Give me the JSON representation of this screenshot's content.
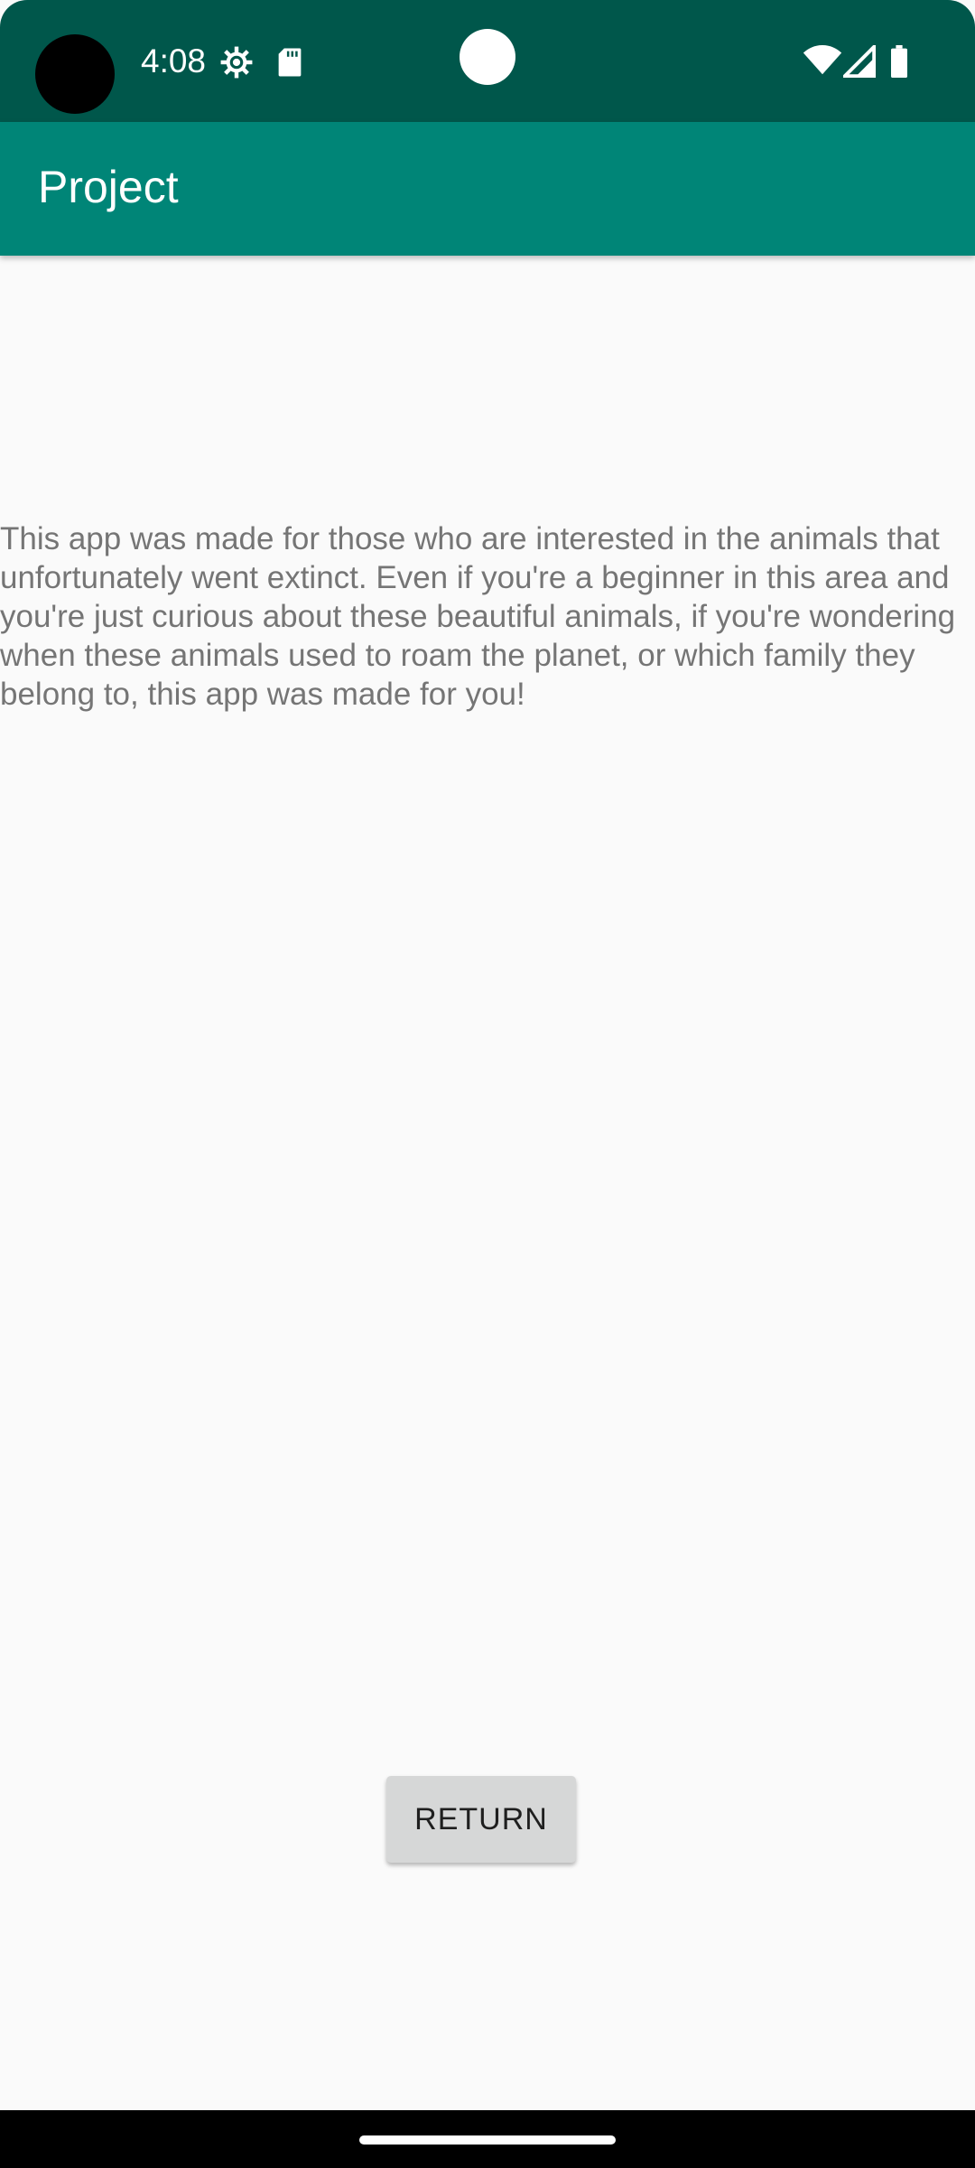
{
  "status_bar": {
    "time": "4:08",
    "icons": [
      "settings-gear-icon",
      "sd-card-icon",
      "wifi-icon",
      "cell-signal-icon",
      "battery-icon"
    ]
  },
  "app_bar": {
    "title": "Project"
  },
  "content": {
    "description": "This app was made for those who are interested in the animals that unfortunately went extinct. Even if you're a beginner in this area and you're just curious about these beautiful animals, if you're wondering when these animals used to roam the planet, or which family they belong to, this app was made for you!",
    "return_button_label": "RETURN"
  },
  "colors": {
    "status_bar": "#00574b",
    "app_bar": "#008577",
    "background": "#fafafa",
    "text": "#757575",
    "button": "#d6d7d7"
  }
}
